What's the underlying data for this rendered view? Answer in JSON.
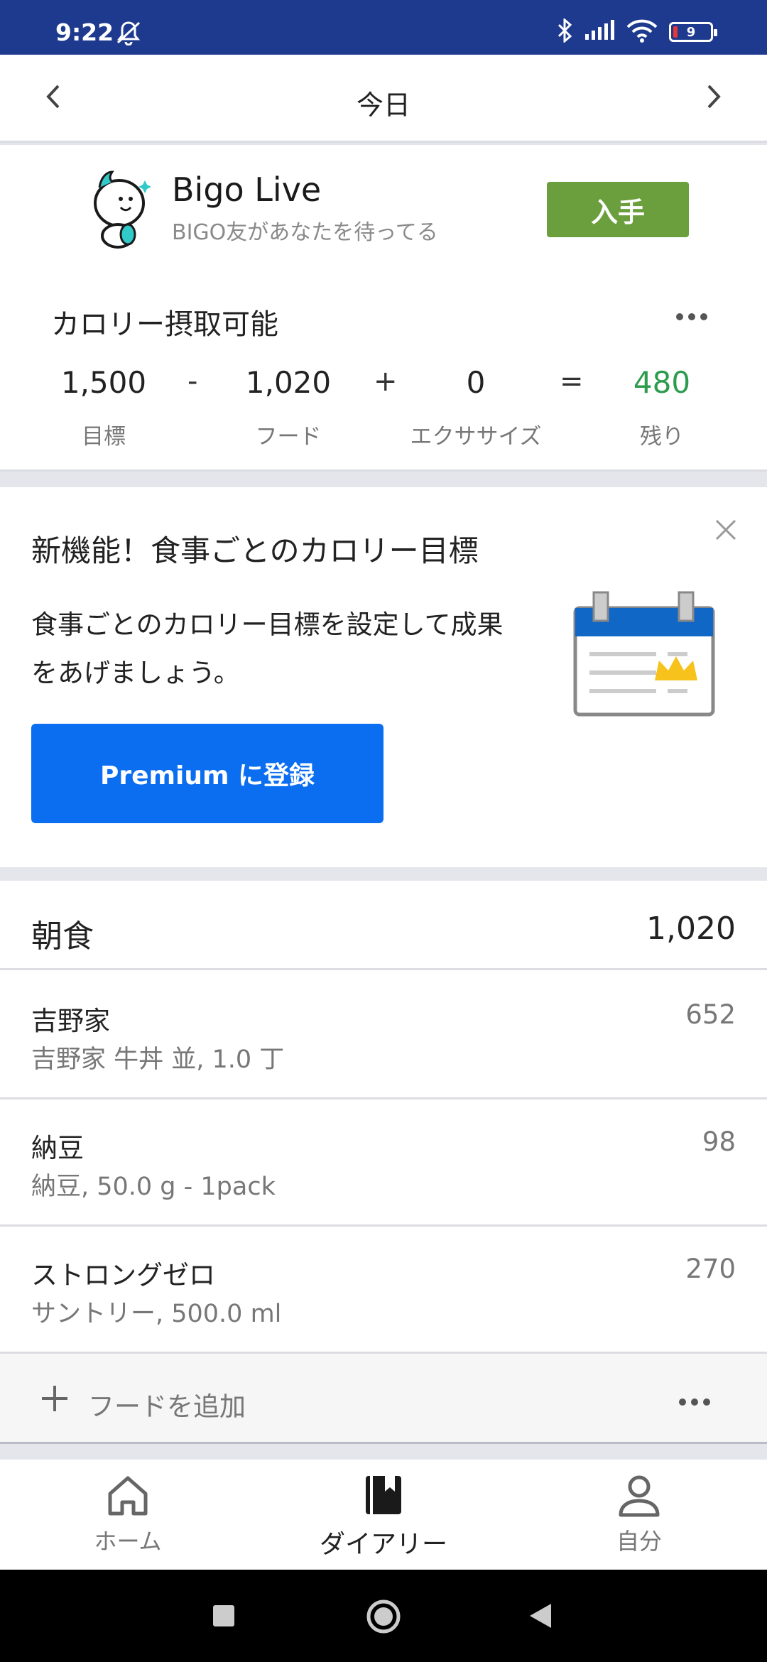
{
  "status_bar": {
    "time": "9:22",
    "battery": "9"
  },
  "header": {
    "title": "今日"
  },
  "ad": {
    "app_name": "Bigo Live",
    "tagline": "BIGO友があなたを待ってる",
    "cta": "入手"
  },
  "calories": {
    "heading": "カロリー摂取可能",
    "goal": {
      "value": "1,500",
      "label": "目標"
    },
    "food": {
      "value": "1,020",
      "label": "フード"
    },
    "exercise": {
      "value": "0",
      "label": "エクササイズ"
    },
    "remaining": {
      "value": "480",
      "label": "残り"
    },
    "op_minus": "-",
    "op_plus": "+",
    "op_equals": "=",
    "remaining_color": "#2e9c4f"
  },
  "promo": {
    "title": "新機能！食事ごとのカロリー目標",
    "description": "食事ごとのカロリー目標を設定して成果をあげましょう。",
    "button": "Premium に登録"
  },
  "meal": {
    "name": "朝食",
    "total": "1,020",
    "items": [
      {
        "name": "吉野家",
        "detail": "吉野家 牛丼 並, 1.0 丁",
        "calories": "652"
      },
      {
        "name": "納豆",
        "detail": "納豆, 50.0 g - 1pack",
        "calories": "98"
      },
      {
        "name": "ストロングゼロ",
        "detail": "サントリー, 500.0 ml",
        "calories": "270"
      }
    ],
    "add_label": "フードを追加"
  },
  "bottom_nav": {
    "home": "ホーム",
    "diary": "ダイアリー",
    "me": "自分"
  },
  "colors": {
    "brand_blue": "#0b6ef0",
    "status_bar": "#1e3a8f",
    "ad_button": "#6b9e3c"
  }
}
